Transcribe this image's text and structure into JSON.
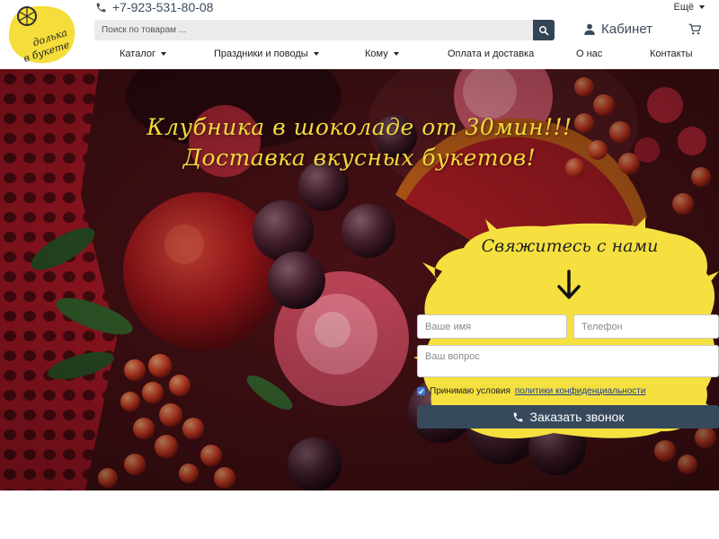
{
  "header": {
    "logo_text": "долька в букете",
    "phone": "+7-923-531-80-08",
    "more_label": "Ещё",
    "search": {
      "placeholder": "Поиск по товарам ..."
    },
    "cabinet_label": "Кабинет",
    "nav": [
      {
        "label": "Каталог",
        "has_dropdown": true
      },
      {
        "label": "Праздники и поводы",
        "has_dropdown": true
      },
      {
        "label": "Кому",
        "has_dropdown": true
      },
      {
        "label": "Оплата и доставка",
        "has_dropdown": false
      },
      {
        "label": "О нас",
        "has_dropdown": false
      },
      {
        "label": "Контакты",
        "has_dropdown": false
      }
    ]
  },
  "hero": {
    "title_line1": "Клубника в шоколаде от 30мин!!!",
    "title_line2": "Доставка вкусных букетов!"
  },
  "contact_form": {
    "heading": "Свяжитесь с нами",
    "name_placeholder": "Ваше имя",
    "phone_placeholder": "Телефон",
    "question_placeholder": "Ваш вопрос",
    "consent_text": "Принимаю условия",
    "consent_link": "политики конфиденциальности",
    "consent_checked": true,
    "submit_label": "Заказать звонок"
  },
  "icons": {
    "phone": "phone-icon",
    "search": "search-icon",
    "user": "user-icon",
    "cart": "cart-icon",
    "arrow": "arrow-down-icon"
  },
  "colors": {
    "accent_yellow": "#f2d93c",
    "dark_slate": "#364a5c",
    "search_bg": "#ebebeb",
    "link": "#1d3f8f",
    "checkbox": "#3878d8"
  }
}
